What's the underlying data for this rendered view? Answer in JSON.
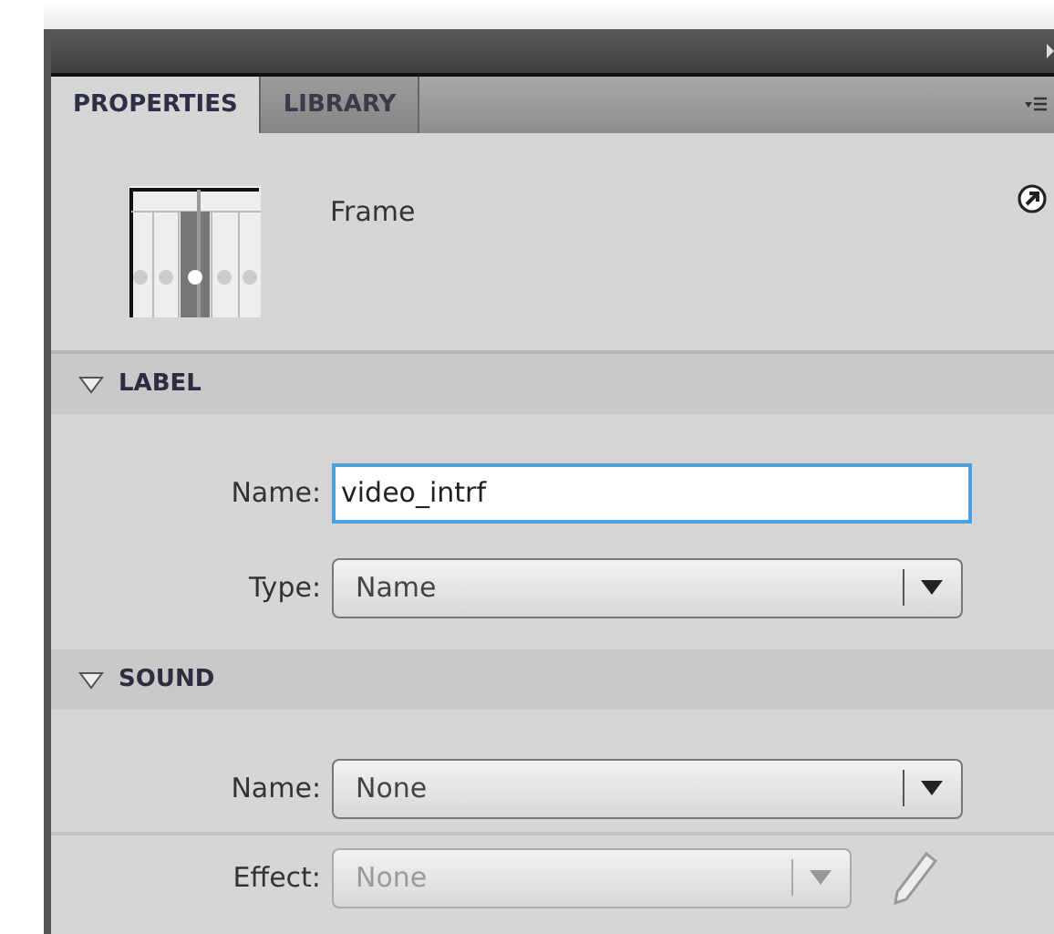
{
  "tabs": [
    {
      "label": "PROPERTIES",
      "selected": true
    },
    {
      "label": "LIBRARY",
      "selected": false
    }
  ],
  "header": {
    "title": "Frame"
  },
  "sections": [
    {
      "title": "LABEL",
      "expanded": true,
      "rows": [
        {
          "kind": "text",
          "label": "Name:",
          "value": "video_intrf",
          "disabled": false
        },
        {
          "kind": "select",
          "label": "Type:",
          "value": "Name",
          "disabled": false
        }
      ]
    },
    {
      "title": "SOUND",
      "expanded": true,
      "rows": [
        {
          "kind": "select",
          "label": "Name:",
          "value": "None",
          "disabled": false
        },
        {
          "kind": "select",
          "label": "Effect:",
          "value": "None",
          "disabled": true,
          "edit_button": true
        }
      ]
    }
  ]
}
